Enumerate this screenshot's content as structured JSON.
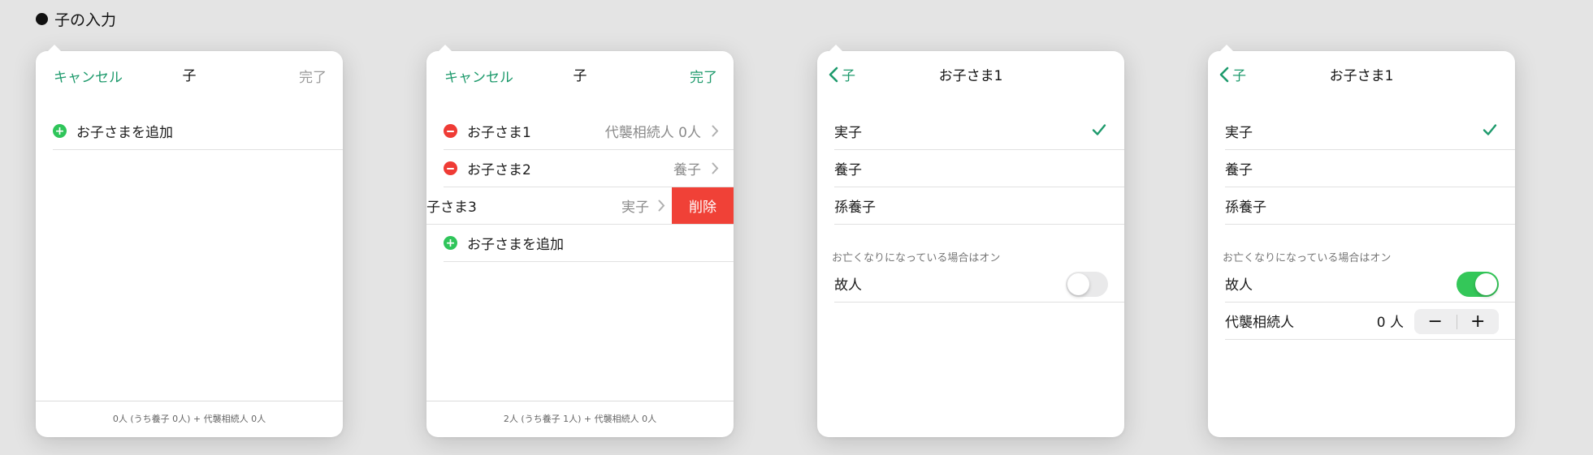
{
  "page": {
    "title": "子の入力"
  },
  "panel1": {
    "nav": {
      "left": "キャンセル",
      "title": "子",
      "right": "完了"
    },
    "add_label": "お子さまを追加",
    "footer": "0人 (うち養子 0人) + 代襲相続人 0人"
  },
  "panel2": {
    "nav": {
      "left": "キャンセル",
      "title": "子",
      "right": "完了"
    },
    "children": [
      {
        "name": "お子さま1",
        "value": "代襲相続人 0人"
      },
      {
        "name": "お子さま2",
        "value": "養子"
      }
    ],
    "swiped": {
      "name": "子さま3",
      "value": "実子",
      "delete_label": "削除"
    },
    "add_label": "お子さまを追加",
    "footer": "2人 (うち養子 1人) + 代襲相続人 0人"
  },
  "panel3": {
    "nav": {
      "back": "子",
      "title": "お子さま1"
    },
    "options": [
      "実子",
      "養子",
      "孫養子"
    ],
    "selected": "実子",
    "section_header": "お亡くなりになっている場合はオン",
    "deceased_label": "故人",
    "deceased_on": false
  },
  "panel4": {
    "nav": {
      "back": "子",
      "title": "お子さま1"
    },
    "options": [
      "実子",
      "養子",
      "孫養子"
    ],
    "selected": "実子",
    "section_header": "お亡くなりになっている場合はオン",
    "deceased_label": "故人",
    "deceased_on": true,
    "heir_label": "代襲相続人",
    "heir_value": "0 人",
    "stepper_minus": "−",
    "stepper_plus": "+"
  },
  "colors": {
    "accent": "#1e9a6c",
    "add": "#2fc55a",
    "remove": "#ef3b35",
    "toggle_on": "#34c759"
  },
  "icons": [
    "add-circle-icon",
    "remove-circle-icon",
    "chevron-right-icon",
    "chevron-left-icon",
    "checkmark-icon"
  ]
}
